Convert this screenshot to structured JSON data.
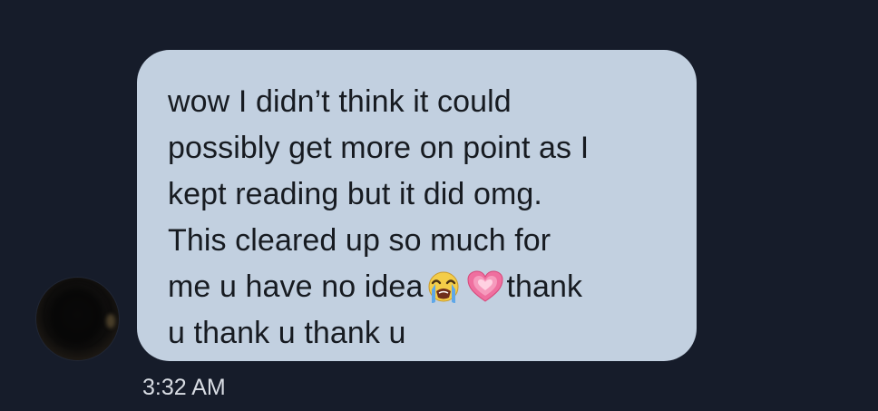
{
  "message": {
    "line1": "wow I didn’t think it could",
    "line2": "possibly get more on point as I",
    "line3": "kept reading but it did omg.",
    "line4": "This cleared up so much for",
    "line5_before_emoji": "me u have no idea",
    "line5_after_emoji": "thank",
    "line6": "u thank u thank u",
    "emojis": [
      "loudly-crying-face-icon",
      "growing-heart-icon"
    ],
    "timestamp": "3:32 AM"
  },
  "colors": {
    "background": "#161c2a",
    "bubble": "#c2d0e0",
    "text": "#171b21",
    "timestamp": "#d8dce3"
  }
}
